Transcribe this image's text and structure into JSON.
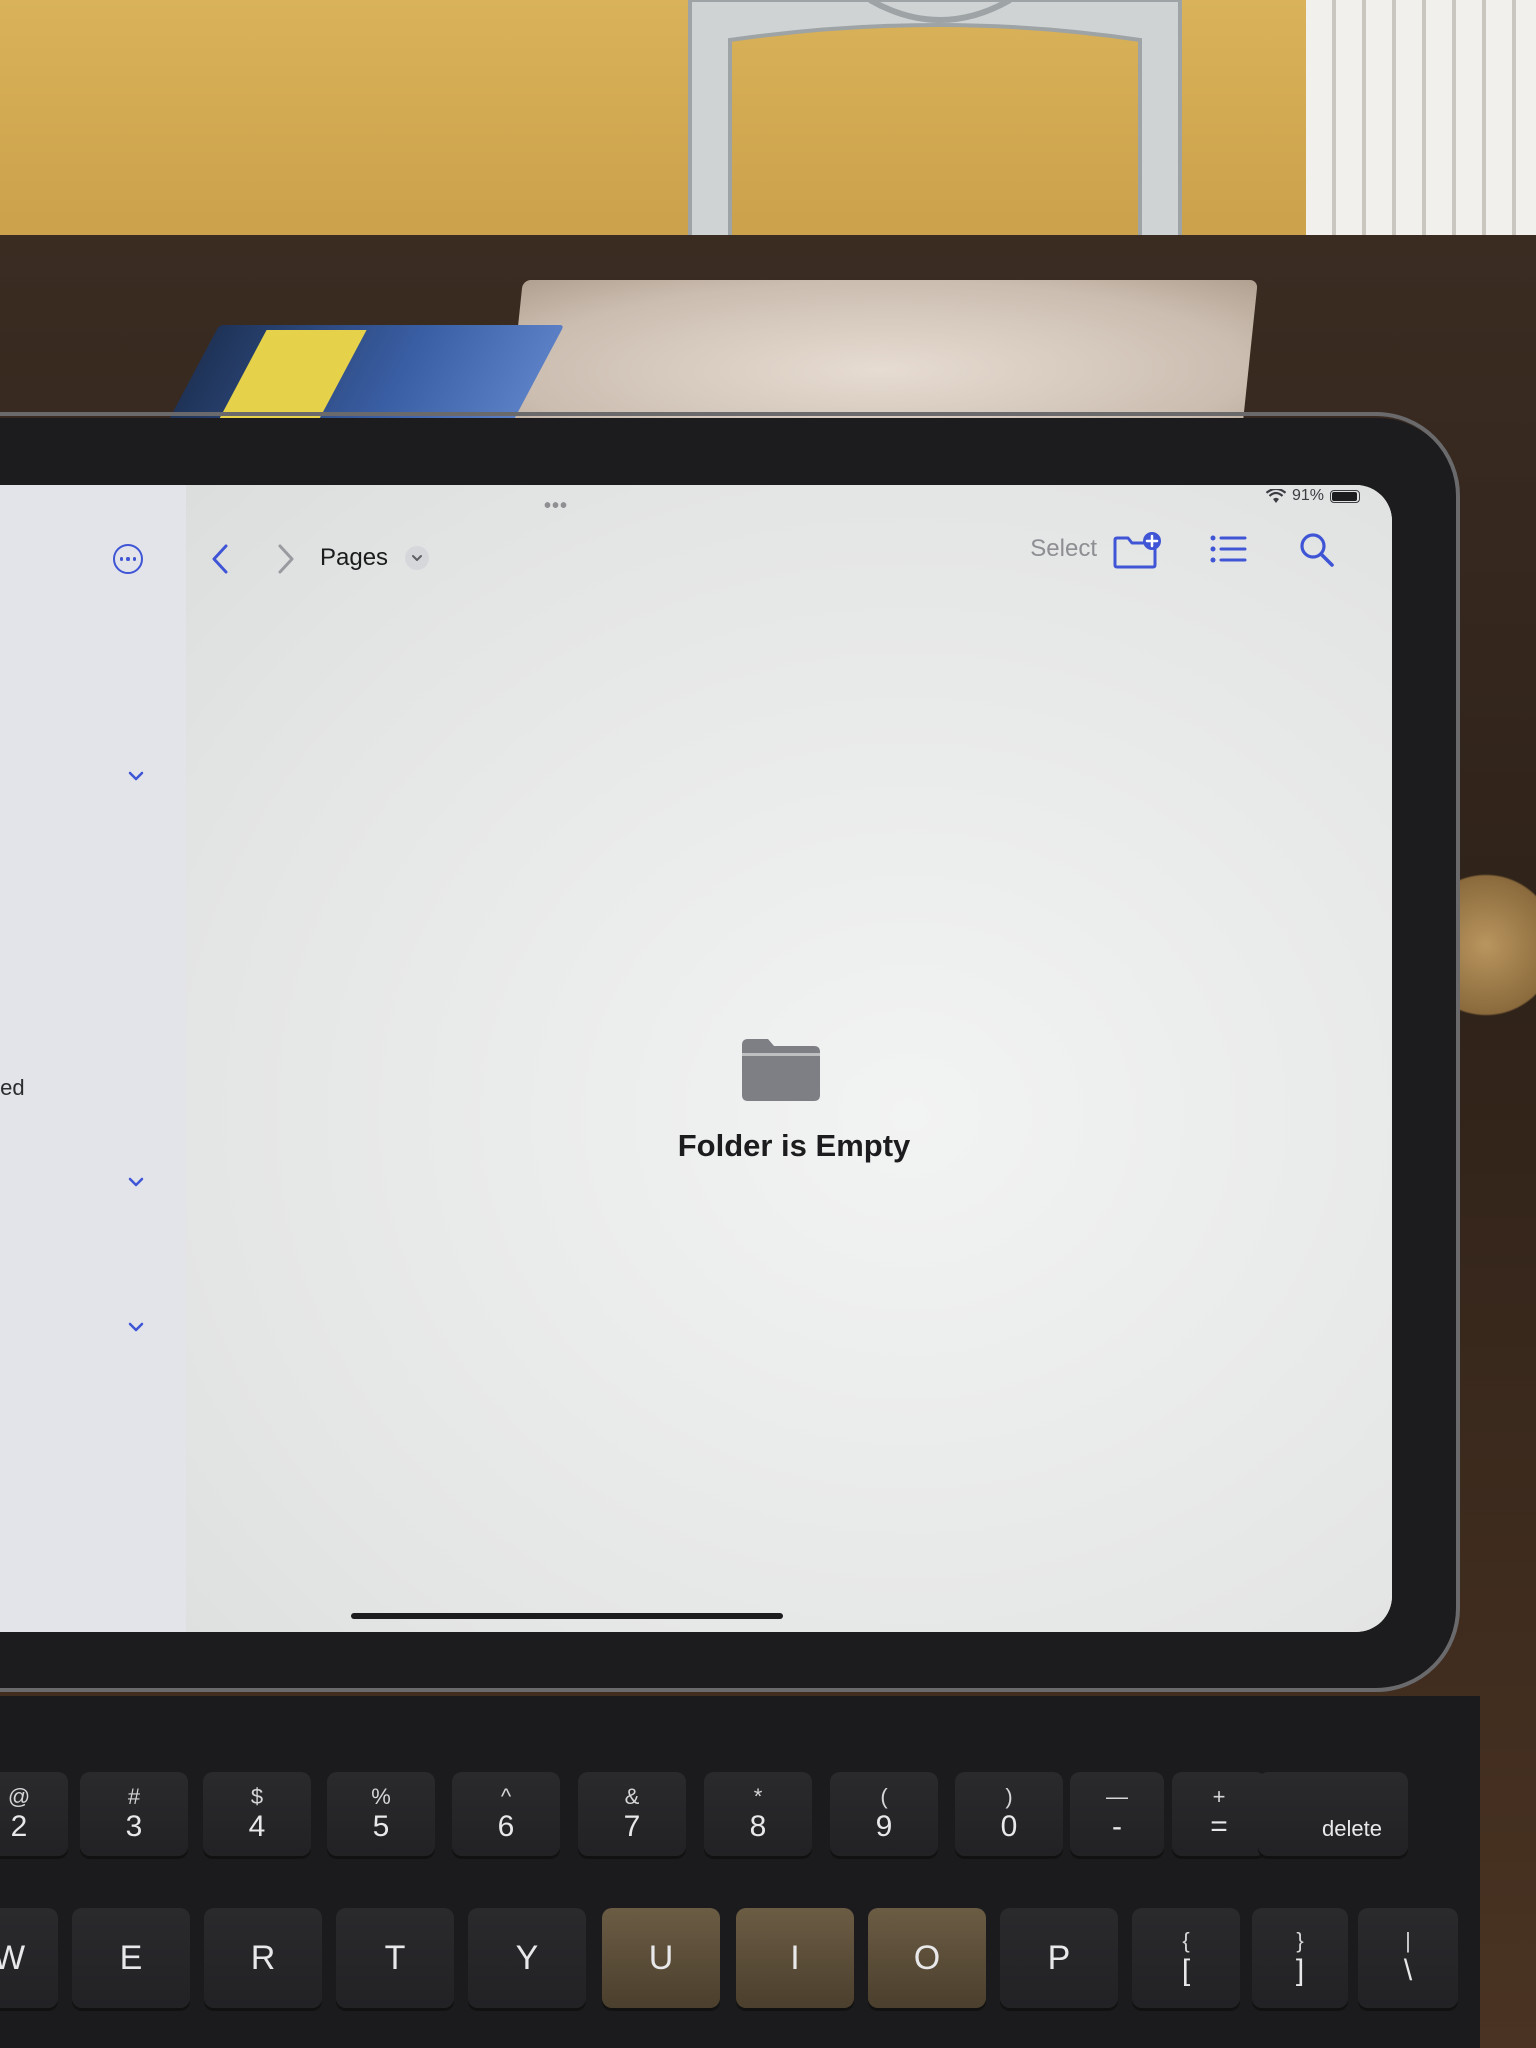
{
  "status_bar": {
    "battery": "91%"
  },
  "toolbar": {
    "breadcrumb": "Pages",
    "select_label": "Select"
  },
  "sidebar": {
    "partial_label": "ted"
  },
  "empty_state": {
    "message": "Folder is Empty"
  },
  "keyboard": {
    "number_row": [
      {
        "top": "@",
        "bottom": "2"
      },
      {
        "top": "#",
        "bottom": "3"
      },
      {
        "top": "$",
        "bottom": "4"
      },
      {
        "top": "%",
        "bottom": "5"
      },
      {
        "top": "^",
        "bottom": "6"
      },
      {
        "top": "&",
        "bottom": "7"
      },
      {
        "top": "*",
        "bottom": "8"
      },
      {
        "top": "(",
        "bottom": "9"
      },
      {
        "top": ")",
        "bottom": "0"
      },
      {
        "top": "—",
        "bottom": "-"
      },
      {
        "top": "+",
        "bottom": "="
      }
    ],
    "delete_label": "delete",
    "letter_row": [
      "W",
      "E",
      "R",
      "T",
      "Y",
      "U",
      "I",
      "O",
      "P"
    ],
    "bracket_keys": [
      {
        "top": "{",
        "bottom": "["
      },
      {
        "top": "}",
        "bottom": "]"
      },
      {
        "top": "|",
        "bottom": "\\"
      }
    ]
  }
}
